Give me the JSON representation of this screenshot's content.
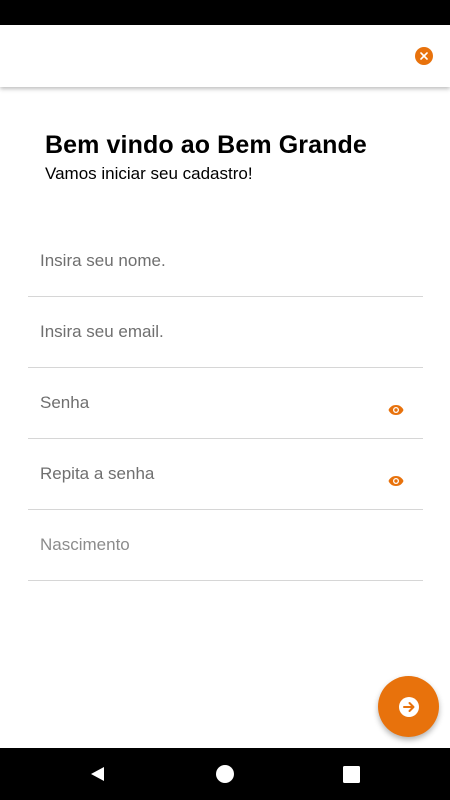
{
  "app": {
    "accent_color": "#e8720c"
  },
  "header": {
    "close_icon": "close-icon"
  },
  "welcome": {
    "title": "Bem vindo ao Bem Grande",
    "subtitle": "Vamos iniciar seu cadastro!"
  },
  "form": {
    "name": {
      "placeholder": "Insira seu nome.",
      "value": ""
    },
    "email": {
      "placeholder": "Insira seu email.",
      "value": ""
    },
    "password": {
      "placeholder": "Senha",
      "value": "",
      "icon": "eye-icon"
    },
    "password_confirm": {
      "placeholder": "Repita a senha",
      "value": "",
      "icon": "eye-icon"
    },
    "birthdate": {
      "placeholder": "Nascimento",
      "value": ""
    }
  },
  "fab": {
    "icon": "arrow-right-icon"
  },
  "navigation": {
    "back_icon": "triangle-back-icon",
    "home_icon": "circle-home-icon",
    "recents_icon": "square-recents-icon"
  }
}
